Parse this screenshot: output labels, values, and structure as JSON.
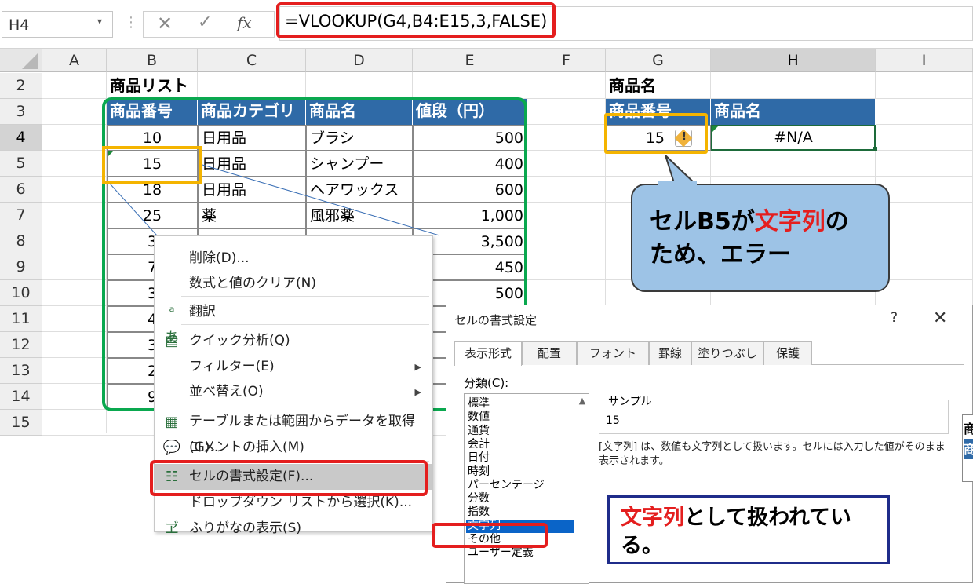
{
  "formula_bar": {
    "name_box": "H4",
    "cancel_icon": "✕",
    "enter_icon": "✓",
    "fx": "fx",
    "formula": "=VLOOKUP(G4,B4:E15,3,FALSE)"
  },
  "grid": {
    "columns": [
      "A",
      "B",
      "C",
      "D",
      "E",
      "F",
      "G",
      "H",
      "I"
    ],
    "rows": [
      "2",
      "3",
      "4",
      "5",
      "6",
      "7",
      "8",
      "9",
      "10",
      "11",
      "12",
      "13",
      "14",
      "15"
    ],
    "list_title": "商品リスト",
    "table_headers": [
      "商品番号",
      "商品カテゴリ",
      "商品名",
      "値段（円）"
    ],
    "table_rows": [
      [
        "10",
        "日用品",
        "ブラシ",
        "500"
      ],
      [
        "15",
        "日用品",
        "シャンプー",
        "400"
      ],
      [
        "18",
        "日用品",
        "ヘアワックス",
        "600"
      ],
      [
        "25",
        "薬",
        "風邪薬",
        "1,000"
      ],
      [
        "3",
        "",
        "",
        "3,500"
      ],
      [
        "7",
        "",
        "",
        "450"
      ],
      [
        "3",
        "",
        "",
        "500"
      ],
      [
        "4",
        "",
        "",
        ""
      ],
      [
        "3",
        "",
        "",
        ""
      ],
      [
        "2",
        "",
        "",
        ""
      ],
      [
        "9",
        "",
        "",
        ""
      ]
    ],
    "lookup_title": "商品名",
    "lookup_headers": [
      "商品番号",
      "商品名"
    ],
    "lookup_value": "15",
    "lookup_result": "#N/A",
    "warning_icon": "!"
  },
  "context_menu": {
    "items": [
      {
        "label": "削除(D)...",
        "icon": ""
      },
      {
        "label": "数式と値のクリア(N)",
        "icon": ""
      },
      {
        "label": "翻訳",
        "icon": "translate-icon"
      },
      {
        "label": "クイック分析(Q)",
        "icon": "quick-analysis-icon"
      },
      {
        "label": "フィルター(E)",
        "icon": ""
      },
      {
        "label": "並べ替え(O)",
        "icon": ""
      },
      {
        "label": "テーブルまたは範囲からデータを取得(G)...",
        "icon": "table-icon"
      },
      {
        "label": "コメントの挿入(M)",
        "icon": "comment-icon"
      },
      {
        "label": "セルの書式設定(F)...",
        "icon": "format-cells-icon"
      },
      {
        "label": "ドロップダウン リストから選択(K)...",
        "icon": ""
      },
      {
        "label": "ふりがなの表示(S)",
        "icon": "furigana-icon"
      }
    ],
    "arrow": "▶"
  },
  "dialog": {
    "title": "セルの書式設定",
    "help": "?",
    "close": "✕",
    "tabs": [
      "表示形式",
      "配置",
      "フォント",
      "罫線",
      "塗りつぶし",
      "保護"
    ],
    "category_label": "分類(C):",
    "categories": [
      "標準",
      "数値",
      "通貨",
      "会計",
      "日付",
      "時刻",
      "パーセンテージ",
      "分数",
      "指数",
      "文字列",
      "その他",
      "ユーザー定義"
    ],
    "selected_category": "文字列",
    "sample_label": "サンプル",
    "sample_value": "15",
    "description": "[文字列] は、数値も文字列として扱います。セルには入力した値がそのまま表示されます。"
  },
  "callouts": {
    "c1_a": "セルB5が",
    "c1_b": "文字列",
    "c1_c": "の",
    "c1_d": "ため、エラー",
    "c2_a": "文字列",
    "c2_b": "として扱われてい",
    "c2_c": "る。"
  },
  "right_edge": {
    "h1": "商",
    "h2": "商"
  },
  "colors": {
    "header_blue": "#2f6aa7",
    "red": "#e41e1e",
    "green": "#0aa84f",
    "orange": "#f4b400",
    "callout_blue": "#9dc3e6",
    "navy": "#1f2c8a"
  }
}
